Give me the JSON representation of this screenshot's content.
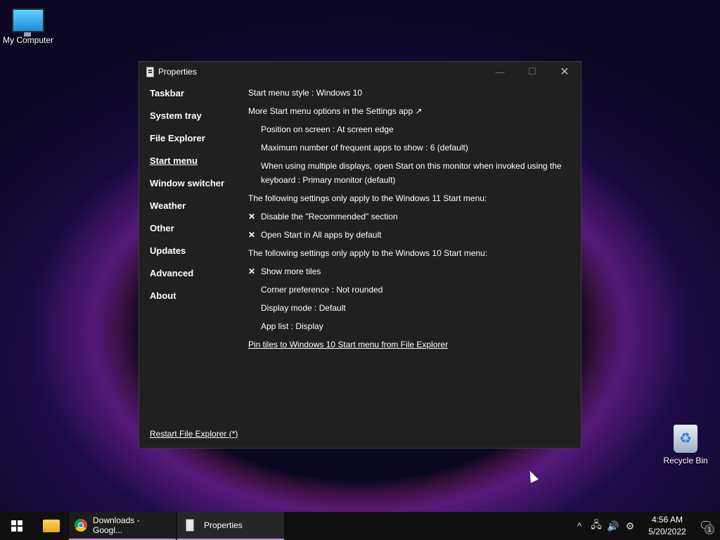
{
  "desktop": {
    "icons": [
      {
        "label": "My Computer",
        "icon": "monitor-icon"
      },
      {
        "label": "Recycle Bin",
        "icon": "recycle-bin-icon"
      }
    ]
  },
  "window": {
    "title": "Properties",
    "controls": {
      "minimize": "—",
      "maximize": "☐",
      "close": "✕"
    },
    "sidebar": {
      "items": [
        "Taskbar",
        "System tray",
        "File Explorer",
        "Start menu",
        "Window switcher",
        "Weather",
        "Other",
        "Updates",
        "Advanced",
        "About"
      ],
      "active": "Start menu"
    },
    "restart_link": "Restart File Explorer (*)",
    "settings": {
      "start_menu_style": "Start menu style : Windows 10",
      "more_options": "More Start menu options in the Settings app ↗",
      "position": "Position on screen : At screen edge",
      "max_frequent": "Maximum number of frequent apps to show : 6 (default)",
      "multi_display": "When using multiple displays, open Start on this monitor when invoked using the keyboard : Primary monitor (default)",
      "win11_header": "The following settings only apply to the Windows 11 Start menu:",
      "disable_recommended": "Disable the \"Recommended\" section",
      "open_all_apps": "Open Start in All apps by default",
      "win10_header": "The following settings only apply to the Windows 10 Start menu:",
      "show_more_tiles": "Show more tiles",
      "corner_pref": "Corner preference : Not rounded",
      "display_mode": "Display mode : Default",
      "app_list": "App list : Display",
      "pin_tiles": "Pin tiles to Windows 10 Start menu from File Explorer",
      "check_mark": "✕"
    }
  },
  "taskbar": {
    "apps": [
      {
        "label": "Downloads - Googl...",
        "icon": "chrome-icon"
      },
      {
        "label": "Properties",
        "icon": "properties-icon"
      }
    ],
    "tray": {
      "chevron": "^",
      "network": "🖧",
      "volume": "🔊",
      "settings": "⚙"
    },
    "clock": {
      "time": "4:56 AM",
      "date": "5/20/2022"
    },
    "notifications": {
      "count": "1"
    }
  }
}
